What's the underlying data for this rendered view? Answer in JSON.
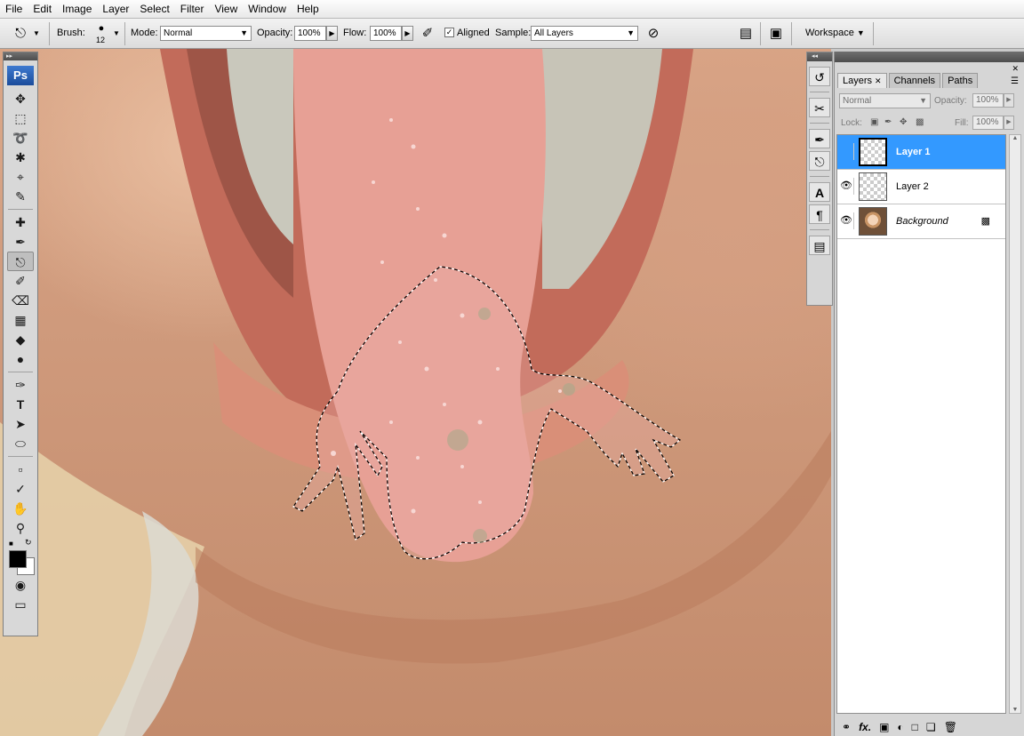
{
  "menu": [
    "File",
    "Edit",
    "Image",
    "Layer",
    "Select",
    "Filter",
    "View",
    "Window",
    "Help"
  ],
  "options": {
    "brush_label": "Brush:",
    "brush_size": "12",
    "mode_label": "Mode:",
    "mode_value": "Normal",
    "opacity_label": "Opacity:",
    "opacity_value": "100%",
    "flow_label": "Flow:",
    "flow_value": "100%",
    "aligned_label": "Aligned",
    "aligned_checked": true,
    "sample_label": "Sample:",
    "sample_value": "All Layers",
    "workspace_label": "Workspace"
  },
  "toolbox": {
    "logo": "Ps"
  },
  "layers_panel": {
    "tabs": [
      "Layers",
      "Channels",
      "Paths"
    ],
    "active_tab": "Layers",
    "blend_mode": "Normal",
    "opacity_label": "Opacity:",
    "opacity_value": "100%",
    "lock_label": "Lock:",
    "fill_label": "Fill:",
    "fill_value": "100%",
    "layers": [
      {
        "name": "Layer 1",
        "visible": false,
        "selected": true,
        "locked": false,
        "thumb": "transparent"
      },
      {
        "name": "Layer 2",
        "visible": true,
        "selected": false,
        "locked": false,
        "thumb": "transparent"
      },
      {
        "name": "Background",
        "visible": true,
        "selected": false,
        "locked": true,
        "thumb": "photo"
      }
    ]
  },
  "colors": {
    "selection_highlight": "#3399ff",
    "foreground": "#000000",
    "background": "#ffffff"
  }
}
